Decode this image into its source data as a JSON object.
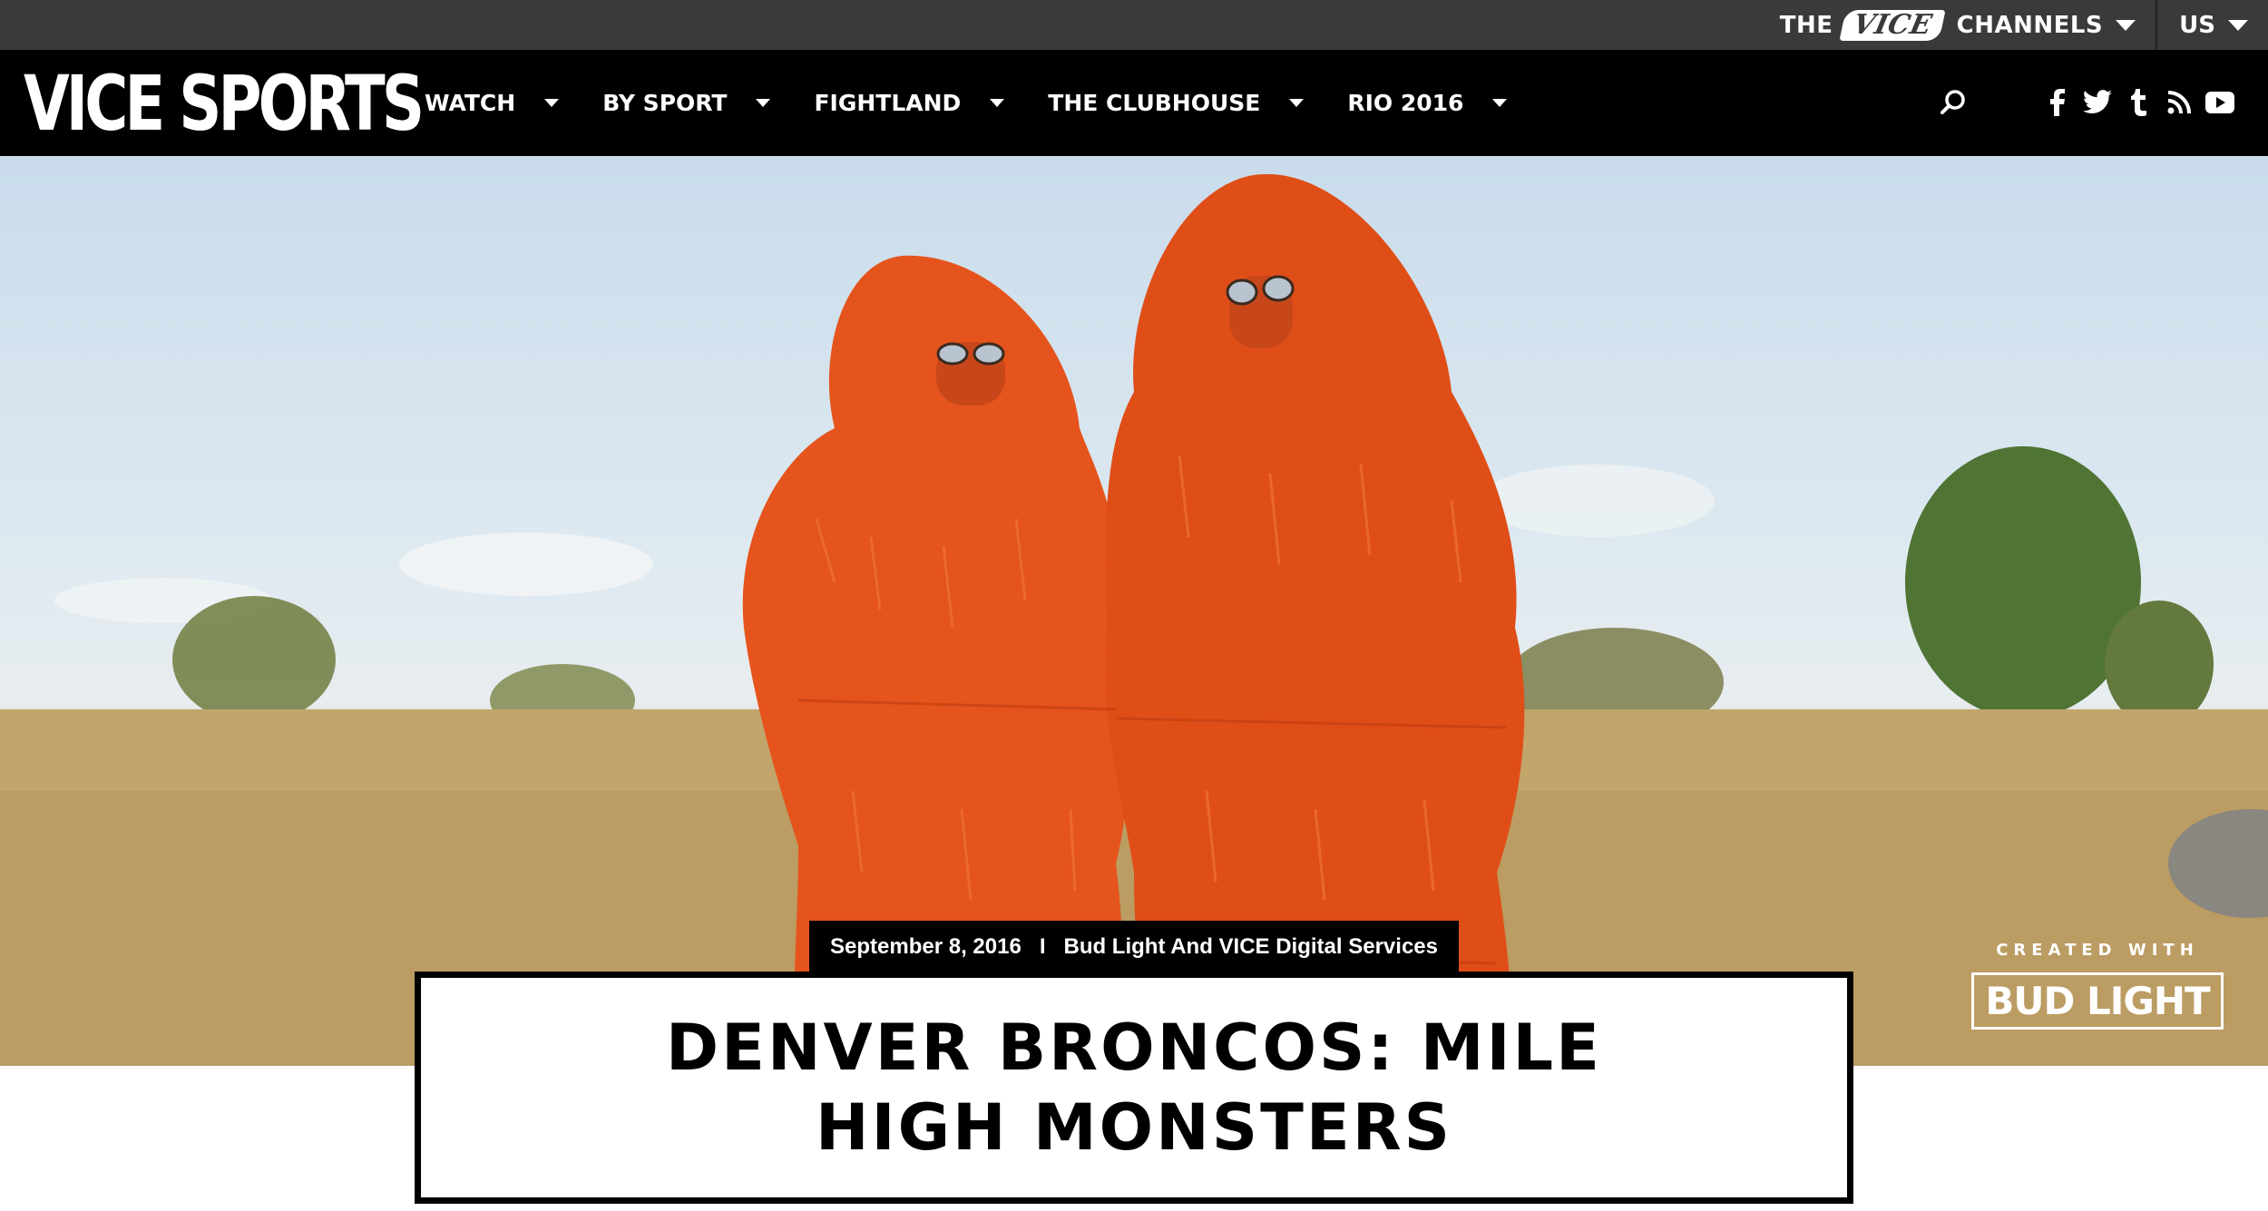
{
  "topbar": {
    "the_label": "THE",
    "vice_logo": "VICE",
    "channels_label": "CHANNELS",
    "region_label": "US"
  },
  "nav": {
    "brand": "VICE SPORTS",
    "items": [
      {
        "label": "WATCH"
      },
      {
        "label": "BY SPORT"
      },
      {
        "label": "FIGHTLAND"
      },
      {
        "label": "THE CLUBHOUSE"
      },
      {
        "label": "RIO 2016"
      }
    ],
    "search_icon": "search-icon",
    "social": [
      {
        "icon": "facebook-icon",
        "glyph": "f"
      },
      {
        "icon": "twitter-icon",
        "glyph": "🐦"
      },
      {
        "icon": "tumblr-icon",
        "glyph": "t"
      },
      {
        "icon": "rss-icon",
        "glyph": "⌒"
      },
      {
        "icon": "youtube-icon",
        "glyph": "▶"
      }
    ]
  },
  "article": {
    "date": "September 8, 2016",
    "separator": "I",
    "author": "Bud Light And VICE Digital Services",
    "title": "DENVER BRONCOS: MILE HIGH MONSTERS"
  },
  "sponsor": {
    "created_with": "CREATED WITH",
    "brand": "BUD LIGHT"
  },
  "colors": {
    "topbar": "#3a3a3a",
    "nav": "#000000",
    "costume": "#e5541c"
  }
}
